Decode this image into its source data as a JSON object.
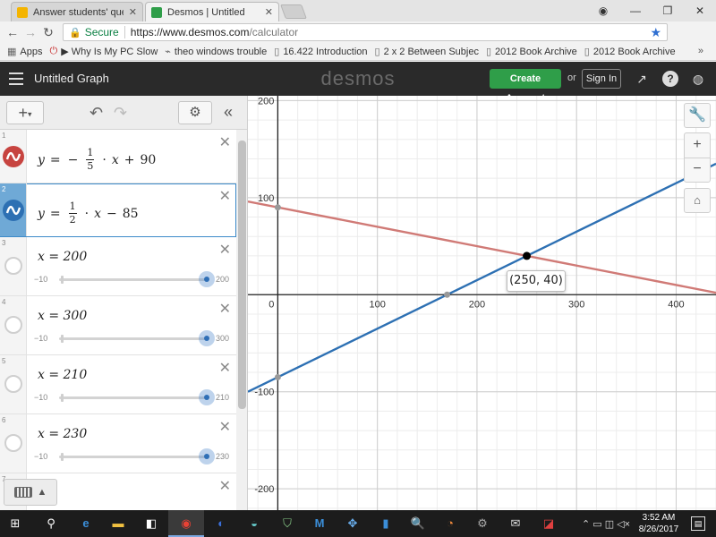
{
  "browser": {
    "tabs": [
      {
        "title": "Answer students' questio",
        "favicon_color": "#f4b400"
      },
      {
        "title": "Desmos | Untitled",
        "favicon_color": "#2f9e49"
      }
    ],
    "window_controls": [
      "minimize-icon",
      "restore-icon",
      "close-icon"
    ],
    "secure_label": "Secure",
    "url_host": "https://www.desmos.com",
    "url_path": "/calculator",
    "bookmarks": [
      {
        "label": "Apps",
        "icon": "apps-grid-icon"
      },
      {
        "label": "▶ Why Is My PC Slow",
        "icon": "power-icon"
      },
      {
        "label": "theo windows trouble",
        "icon": "link-icon"
      },
      {
        "label": "16.422 Introduction",
        "icon": "page-icon"
      },
      {
        "label": "2 x 2 Between Subjec",
        "icon": "page-icon"
      },
      {
        "label": "2012 Book Archive",
        "icon": "page-icon"
      },
      {
        "label": "2012 Book Archive",
        "icon": "page-icon"
      }
    ],
    "bookmarks_more": "»"
  },
  "desmos": {
    "graph_title": "Untitled Graph",
    "brand": "desmos",
    "create_account": "Create Account",
    "or": "or",
    "sign_in": "Sign In",
    "accent_green": "#2f9e49"
  },
  "expressions": [
    {
      "index": "1",
      "kind": "line",
      "color": "#c74440",
      "lhs": "y",
      "eq": "=",
      "sign": "−",
      "num": "1",
      "den": "5",
      "var": "x",
      "op": "+",
      "const": "90"
    },
    {
      "index": "2",
      "kind": "line",
      "color": "#2d70b3",
      "lhs": "y",
      "eq": "=",
      "sign": "",
      "num": "1",
      "den": "2",
      "var": "x",
      "op": "−",
      "const": "85"
    },
    {
      "index": "3",
      "kind": "slider",
      "text": "x = 200",
      "min": "−10",
      "max": "200"
    },
    {
      "index": "4",
      "kind": "slider",
      "text": "x = 300",
      "min": "−10",
      "max": "300"
    },
    {
      "index": "5",
      "kind": "slider",
      "text": "x = 210",
      "min": "−10",
      "max": "210"
    },
    {
      "index": "6",
      "kind": "slider",
      "text": "x = 230",
      "min": "−10",
      "max": "230"
    },
    {
      "index": "7",
      "kind": "empty"
    }
  ],
  "graph": {
    "x_ticks": [
      "0",
      "100",
      "200",
      "300",
      "400"
    ],
    "y_ticks": [
      "200",
      "100",
      "-100",
      "-200"
    ],
    "xlim": [
      -30,
      440
    ],
    "ylim": [
      -222,
      205
    ],
    "lines": [
      {
        "name": "y = −1/5·x + 90",
        "slope": -0.2,
        "intercept": 90,
        "color": "#d07a76"
      },
      {
        "name": "y = 1/2·x − 85",
        "slope": 0.5,
        "intercept": -85,
        "color": "#2d70b3"
      }
    ],
    "intersection": {
      "x": 250,
      "y": 40,
      "label": "(250, 40)"
    },
    "tools": [
      "wrench-icon",
      "zoom-in-icon",
      "zoom-out-icon",
      "home-icon"
    ]
  },
  "taskbar": {
    "time": "3:52 AM",
    "date": "8/26/2017"
  }
}
